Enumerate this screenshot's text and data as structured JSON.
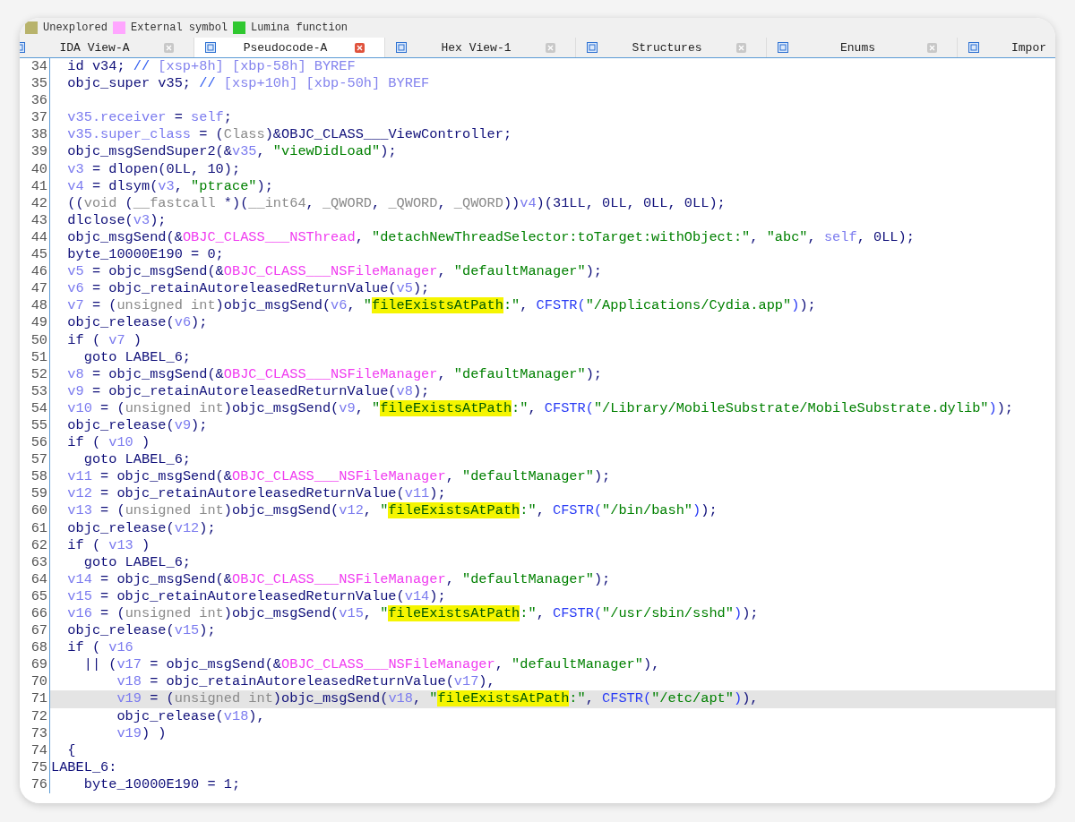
{
  "legend": [
    {
      "label": "Unexplored",
      "color": "#b8b36c"
    },
    {
      "label": "External symbol",
      "color": "#ffa6ff"
    },
    {
      "label": "Lumina function",
      "color": "#30c830"
    }
  ],
  "tabs": [
    {
      "label": "IDA View-A",
      "selected": false
    },
    {
      "label": "Pseudocode-A",
      "selected": true
    },
    {
      "label": "Hex View-1",
      "selected": false
    },
    {
      "label": "Structures",
      "selected": false
    },
    {
      "label": "Enums",
      "selected": false
    },
    {
      "label": "Impor",
      "selected": false
    }
  ],
  "lines": [
    {
      "number": "34",
      "current": false,
      "tokens": [
        {
          "kind": "plain",
          "text": "  id v34; "
        },
        {
          "kind": "comment",
          "text": "//"
        },
        {
          "kind": "note",
          "text": " [xsp+8h] [xbp-58h] BYREF"
        }
      ]
    },
    {
      "number": "35",
      "current": false,
      "tokens": [
        {
          "kind": "plain",
          "text": "  objc_super v35; "
        },
        {
          "kind": "comment",
          "text": "//"
        },
        {
          "kind": "note",
          "text": " [xsp+10h] [xbp-50h] BYREF"
        }
      ]
    },
    {
      "number": "36",
      "current": false
    },
    {
      "number": "37",
      "current": false,
      "tokens": [
        {
          "kind": "var",
          "text": "  v35.receiver"
        },
        {
          "kind": "plain",
          "text": " = "
        },
        {
          "kind": "var",
          "text": "self"
        },
        {
          "kind": "plain",
          "text": ";"
        }
      ]
    },
    {
      "number": "38",
      "current": false,
      "tokens": [
        {
          "kind": "var",
          "text": "  v35.super_class"
        },
        {
          "kind": "plain",
          "text": " = ("
        },
        {
          "kind": "type",
          "text": "Class"
        },
        {
          "kind": "plain",
          "text": ")&OBJC_CLASS___ViewController;"
        }
      ]
    },
    {
      "number": "39",
      "current": false,
      "tokens": [
        {
          "kind": "plain",
          "text": "  objc_msgSendSuper2(&"
        },
        {
          "kind": "var",
          "text": "v35"
        },
        {
          "kind": "plain",
          "text": ", "
        },
        {
          "kind": "string",
          "text": "\"viewDidLoad\""
        },
        {
          "kind": "plain",
          "text": ");"
        }
      ]
    },
    {
      "number": "40",
      "current": false,
      "tokens": [
        {
          "kind": "var",
          "text": "  v3"
        },
        {
          "kind": "plain",
          "text": " = dlopen(0LL, 10);"
        }
      ]
    },
    {
      "number": "41",
      "current": false,
      "tokens": [
        {
          "kind": "var",
          "text": "  v4"
        },
        {
          "kind": "plain",
          "text": " = dlsym("
        },
        {
          "kind": "var",
          "text": "v3"
        },
        {
          "kind": "plain",
          "text": ", "
        },
        {
          "kind": "string",
          "text": "\"ptrace\""
        },
        {
          "kind": "plain",
          "text": ");"
        }
      ]
    },
    {
      "number": "42",
      "current": false,
      "tokens": [
        {
          "kind": "plain",
          "text": "  (("
        },
        {
          "kind": "type",
          "text": "void"
        },
        {
          "kind": "plain",
          "text": " ("
        },
        {
          "kind": "type",
          "text": "__fastcall"
        },
        {
          "kind": "plain",
          "text": " *)("
        },
        {
          "kind": "type",
          "text": "__int64"
        },
        {
          "kind": "plain",
          "text": ", "
        },
        {
          "kind": "type",
          "text": "_QWORD"
        },
        {
          "kind": "plain",
          "text": ", "
        },
        {
          "kind": "type",
          "text": "_QWORD"
        },
        {
          "kind": "plain",
          "text": ", "
        },
        {
          "kind": "type",
          "text": "_QWORD"
        },
        {
          "kind": "plain",
          "text": "))"
        },
        {
          "kind": "var",
          "text": "v4"
        },
        {
          "kind": "plain",
          "text": ")(31LL, 0LL, 0LL, 0LL);"
        }
      ]
    },
    {
      "number": "43",
      "current": false,
      "tokens": [
        {
          "kind": "plain",
          "text": "  dlclose("
        },
        {
          "kind": "var",
          "text": "v3"
        },
        {
          "kind": "plain",
          "text": ");"
        }
      ]
    },
    {
      "number": "44",
      "current": false,
      "tokens": [
        {
          "kind": "plain",
          "text": "  objc_msgSend(&"
        },
        {
          "kind": "extern",
          "text": "OBJC_CLASS___NSThread"
        },
        {
          "kind": "plain",
          "text": ", "
        },
        {
          "kind": "string",
          "text": "\"detachNewThreadSelector:toTarget:withObject:\""
        },
        {
          "kind": "plain",
          "text": ", "
        },
        {
          "kind": "string",
          "text": "\"abc\""
        },
        {
          "kind": "plain",
          "text": ", "
        },
        {
          "kind": "var",
          "text": "self"
        },
        {
          "kind": "plain",
          "text": ", 0LL);"
        }
      ]
    },
    {
      "number": "45",
      "current": false,
      "tokens": [
        {
          "kind": "plain",
          "text": "  byte_10000E190 = 0;"
        }
      ]
    },
    {
      "number": "46",
      "current": false,
      "tokens": [
        {
          "kind": "var",
          "text": "  v5"
        },
        {
          "kind": "plain",
          "text": " = objc_msgSend(&"
        },
        {
          "kind": "extern",
          "text": "OBJC_CLASS___NSFileManager"
        },
        {
          "kind": "plain",
          "text": ", "
        },
        {
          "kind": "string",
          "text": "\"defaultManager\""
        },
        {
          "kind": "plain",
          "text": ");"
        }
      ]
    },
    {
      "number": "47",
      "current": false,
      "tokens": [
        {
          "kind": "var",
          "text": "  v6"
        },
        {
          "kind": "plain",
          "text": " = objc_retainAutoreleasedReturnValue("
        },
        {
          "kind": "var",
          "text": "v5"
        },
        {
          "kind": "plain",
          "text": ");"
        }
      ]
    },
    {
      "number": "48",
      "current": false,
      "tokens": [
        {
          "kind": "var",
          "text": "  v7"
        },
        {
          "kind": "plain",
          "text": " = ("
        },
        {
          "kind": "type",
          "text": "unsigned int"
        },
        {
          "kind": "plain",
          "text": ")objc_msgSend("
        },
        {
          "kind": "var",
          "text": "v6"
        },
        {
          "kind": "plain",
          "text": ", "
        },
        {
          "kind": "string",
          "text": "\""
        },
        {
          "kind": "match",
          "text": "fileExistsAtPath"
        },
        {
          "kind": "string",
          "text": ":\""
        },
        {
          "kind": "plain",
          "text": ", "
        },
        {
          "kind": "macro",
          "text": "CFSTR("
        },
        {
          "kind": "string",
          "text": "\"/Applications/Cydia.app\""
        },
        {
          "kind": "macro",
          "text": ")"
        },
        {
          "kind": "plain",
          "text": ");"
        }
      ]
    },
    {
      "number": "49",
      "current": false,
      "tokens": [
        {
          "kind": "plain",
          "text": "  objc_release("
        },
        {
          "kind": "var",
          "text": "v6"
        },
        {
          "kind": "plain",
          "text": ");"
        }
      ]
    },
    {
      "number": "50",
      "current": false,
      "tokens": [
        {
          "kind": "plain",
          "text": "  if ( "
        },
        {
          "kind": "var",
          "text": "v7"
        },
        {
          "kind": "plain",
          "text": " )"
        }
      ]
    },
    {
      "number": "51",
      "current": false,
      "tokens": [
        {
          "kind": "plain",
          "text": "    goto LABEL_6;"
        }
      ]
    },
    {
      "number": "52",
      "current": false,
      "tokens": [
        {
          "kind": "var",
          "text": "  v8"
        },
        {
          "kind": "plain",
          "text": " = objc_msgSend(&"
        },
        {
          "kind": "extern",
          "text": "OBJC_CLASS___NSFileManager"
        },
        {
          "kind": "plain",
          "text": ", "
        },
        {
          "kind": "string",
          "text": "\"defaultManager\""
        },
        {
          "kind": "plain",
          "text": ");"
        }
      ]
    },
    {
      "number": "53",
      "current": false,
      "tokens": [
        {
          "kind": "var",
          "text": "  v9"
        },
        {
          "kind": "plain",
          "text": " = objc_retainAutoreleasedReturnValue("
        },
        {
          "kind": "var",
          "text": "v8"
        },
        {
          "kind": "plain",
          "text": ");"
        }
      ]
    },
    {
      "number": "54",
      "current": false,
      "tokens": [
        {
          "kind": "var",
          "text": "  v10"
        },
        {
          "kind": "plain",
          "text": " = ("
        },
        {
          "kind": "type",
          "text": "unsigned int"
        },
        {
          "kind": "plain",
          "text": ")objc_msgSend("
        },
        {
          "kind": "var",
          "text": "v9"
        },
        {
          "kind": "plain",
          "text": ", "
        },
        {
          "kind": "string",
          "text": "\""
        },
        {
          "kind": "match",
          "text": "fileExistsAtPath"
        },
        {
          "kind": "string",
          "text": ":\""
        },
        {
          "kind": "plain",
          "text": ", "
        },
        {
          "kind": "macro",
          "text": "CFSTR("
        },
        {
          "kind": "string",
          "text": "\"/Library/MobileSubstrate/MobileSubstrate.dylib\""
        },
        {
          "kind": "macro",
          "text": ")"
        },
        {
          "kind": "plain",
          "text": ");"
        }
      ]
    },
    {
      "number": "55",
      "current": false,
      "tokens": [
        {
          "kind": "plain",
          "text": "  objc_release("
        },
        {
          "kind": "var",
          "text": "v9"
        },
        {
          "kind": "plain",
          "text": ");"
        }
      ]
    },
    {
      "number": "56",
      "current": false,
      "tokens": [
        {
          "kind": "plain",
          "text": "  if ( "
        },
        {
          "kind": "var",
          "text": "v10"
        },
        {
          "kind": "plain",
          "text": " )"
        }
      ]
    },
    {
      "number": "57",
      "current": false,
      "tokens": [
        {
          "kind": "plain",
          "text": "    goto LABEL_6;"
        }
      ]
    },
    {
      "number": "58",
      "current": false,
      "tokens": [
        {
          "kind": "var",
          "text": "  v11"
        },
        {
          "kind": "plain",
          "text": " = objc_msgSend(&"
        },
        {
          "kind": "extern",
          "text": "OBJC_CLASS___NSFileManager"
        },
        {
          "kind": "plain",
          "text": ", "
        },
        {
          "kind": "string",
          "text": "\"defaultManager\""
        },
        {
          "kind": "plain",
          "text": ");"
        }
      ]
    },
    {
      "number": "59",
      "current": false,
      "tokens": [
        {
          "kind": "var",
          "text": "  v12"
        },
        {
          "kind": "plain",
          "text": " = objc_retainAutoreleasedReturnValue("
        },
        {
          "kind": "var",
          "text": "v11"
        },
        {
          "kind": "plain",
          "text": ");"
        }
      ]
    },
    {
      "number": "60",
      "current": false,
      "tokens": [
        {
          "kind": "var",
          "text": "  v13"
        },
        {
          "kind": "plain",
          "text": " = ("
        },
        {
          "kind": "type",
          "text": "unsigned int"
        },
        {
          "kind": "plain",
          "text": ")objc_msgSend("
        },
        {
          "kind": "var",
          "text": "v12"
        },
        {
          "kind": "plain",
          "text": ", "
        },
        {
          "kind": "string",
          "text": "\""
        },
        {
          "kind": "match",
          "text": "fileExistsAtPath"
        },
        {
          "kind": "string",
          "text": ":\""
        },
        {
          "kind": "plain",
          "text": ", "
        },
        {
          "kind": "macro",
          "text": "CFSTR("
        },
        {
          "kind": "string",
          "text": "\"/bin/bash\""
        },
        {
          "kind": "macro",
          "text": ")"
        },
        {
          "kind": "plain",
          "text": ");"
        }
      ]
    },
    {
      "number": "61",
      "current": false,
      "tokens": [
        {
          "kind": "plain",
          "text": "  objc_release("
        },
        {
          "kind": "var",
          "text": "v12"
        },
        {
          "kind": "plain",
          "text": ");"
        }
      ]
    },
    {
      "number": "62",
      "current": false,
      "tokens": [
        {
          "kind": "plain",
          "text": "  if ( "
        },
        {
          "kind": "var",
          "text": "v13"
        },
        {
          "kind": "plain",
          "text": " )"
        }
      ]
    },
    {
      "number": "63",
      "current": false,
      "tokens": [
        {
          "kind": "plain",
          "text": "    goto LABEL_6;"
        }
      ]
    },
    {
      "number": "64",
      "current": false,
      "tokens": [
        {
          "kind": "var",
          "text": "  v14"
        },
        {
          "kind": "plain",
          "text": " = objc_msgSend(&"
        },
        {
          "kind": "extern",
          "text": "OBJC_CLASS___NSFileManager"
        },
        {
          "kind": "plain",
          "text": ", "
        },
        {
          "kind": "string",
          "text": "\"defaultManager\""
        },
        {
          "kind": "plain",
          "text": ");"
        }
      ]
    },
    {
      "number": "65",
      "current": false,
      "tokens": [
        {
          "kind": "var",
          "text": "  v15"
        },
        {
          "kind": "plain",
          "text": " = objc_retainAutoreleasedReturnValue("
        },
        {
          "kind": "var",
          "text": "v14"
        },
        {
          "kind": "plain",
          "text": ");"
        }
      ]
    },
    {
      "number": "66",
      "current": false,
      "tokens": [
        {
          "kind": "var",
          "text": "  v16"
        },
        {
          "kind": "plain",
          "text": " = ("
        },
        {
          "kind": "type",
          "text": "unsigned int"
        },
        {
          "kind": "plain",
          "text": ")objc_msgSend("
        },
        {
          "kind": "var",
          "text": "v15"
        },
        {
          "kind": "plain",
          "text": ", "
        },
        {
          "kind": "string",
          "text": "\""
        },
        {
          "kind": "match",
          "text": "fileExistsAtPath"
        },
        {
          "kind": "string",
          "text": ":\""
        },
        {
          "kind": "plain",
          "text": ", "
        },
        {
          "kind": "macro",
          "text": "CFSTR("
        },
        {
          "kind": "string",
          "text": "\"/usr/sbin/sshd\""
        },
        {
          "kind": "macro",
          "text": ")"
        },
        {
          "kind": "plain",
          "text": ");"
        }
      ]
    },
    {
      "number": "67",
      "current": false,
      "tokens": [
        {
          "kind": "plain",
          "text": "  objc_release("
        },
        {
          "kind": "var",
          "text": "v15"
        },
        {
          "kind": "plain",
          "text": ");"
        }
      ]
    },
    {
      "number": "68",
      "current": false,
      "tokens": [
        {
          "kind": "plain",
          "text": "  if ( "
        },
        {
          "kind": "var",
          "text": "v16"
        }
      ]
    },
    {
      "number": "69",
      "current": false,
      "tokens": [
        {
          "kind": "plain",
          "text": "    || ("
        },
        {
          "kind": "var",
          "text": "v17"
        },
        {
          "kind": "plain",
          "text": " = objc_msgSend(&"
        },
        {
          "kind": "extern",
          "text": "OBJC_CLASS___NSFileManager"
        },
        {
          "kind": "plain",
          "text": ", "
        },
        {
          "kind": "string",
          "text": "\"defaultManager\""
        },
        {
          "kind": "plain",
          "text": "),"
        }
      ]
    },
    {
      "number": "70",
      "current": false,
      "tokens": [
        {
          "kind": "var",
          "text": "        v18"
        },
        {
          "kind": "plain",
          "text": " = objc_retainAutoreleasedReturnValue("
        },
        {
          "kind": "var",
          "text": "v17"
        },
        {
          "kind": "plain",
          "text": "),"
        }
      ]
    },
    {
      "number": "71",
      "current": true,
      "tokens": [
        {
          "kind": "var",
          "text": "        v19"
        },
        {
          "kind": "plain",
          "text": " = ("
        },
        {
          "kind": "type",
          "text": "unsigned int"
        },
        {
          "kind": "plain",
          "text": ")objc_msgSend("
        },
        {
          "kind": "var",
          "text": "v18"
        },
        {
          "kind": "plain",
          "text": ", "
        },
        {
          "kind": "string",
          "text": "\""
        },
        {
          "kind": "match",
          "text": "fileExistsAtPath"
        },
        {
          "kind": "string",
          "text": ":\""
        },
        {
          "kind": "plain",
          "text": ", "
        },
        {
          "kind": "macro",
          "text": "CFSTR("
        },
        {
          "kind": "string",
          "text": "\"/etc/apt\""
        },
        {
          "kind": "macro",
          "text": ")"
        },
        {
          "kind": "plain",
          "text": "),"
        }
      ]
    },
    {
      "number": "72",
      "current": false,
      "tokens": [
        {
          "kind": "plain",
          "text": "        objc_release("
        },
        {
          "kind": "var",
          "text": "v18"
        },
        {
          "kind": "plain",
          "text": "),"
        }
      ]
    },
    {
      "number": "73",
      "current": false,
      "tokens": [
        {
          "kind": "var",
          "text": "        v19"
        },
        {
          "kind": "plain",
          "text": ") )"
        }
      ]
    },
    {
      "number": "74",
      "current": false,
      "tokens": [
        {
          "kind": "plain",
          "text": "  {"
        }
      ]
    },
    {
      "number": "75",
      "current": false,
      "tokens": [
        {
          "kind": "plain",
          "text": "LABEL_6:"
        }
      ]
    },
    {
      "number": "76",
      "current": false,
      "tokens": [
        {
          "kind": "plain",
          "text": "    byte_10000E190 = 1;"
        }
      ]
    }
  ]
}
